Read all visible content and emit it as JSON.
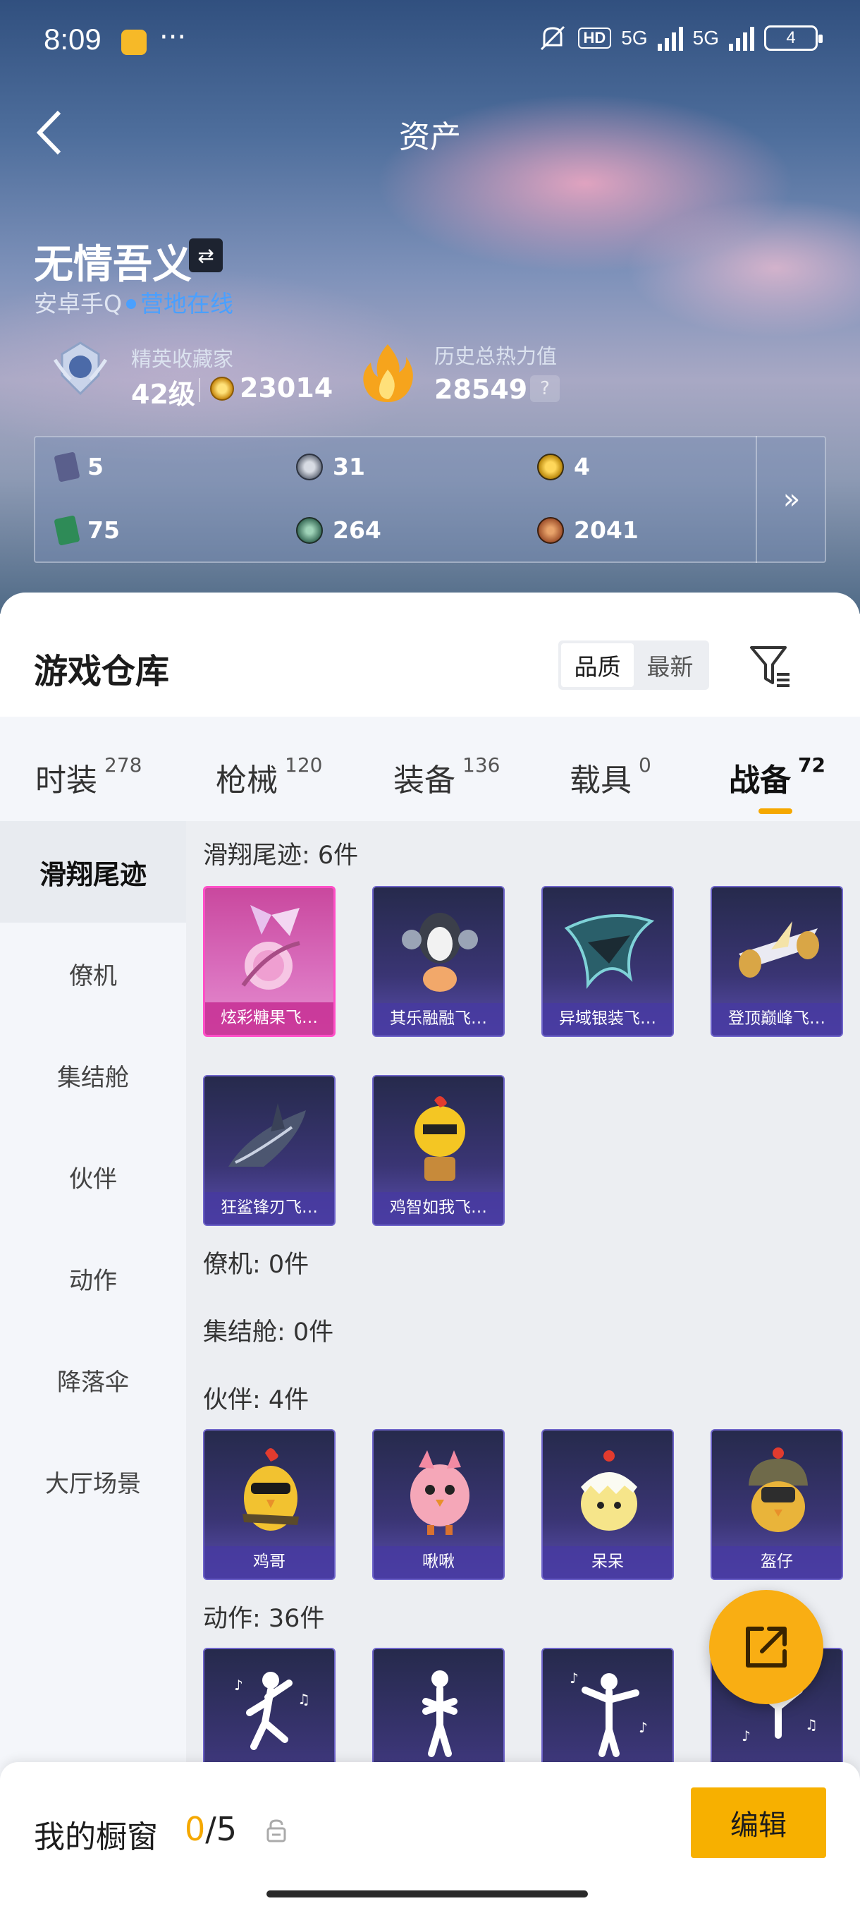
{
  "status_bar": {
    "time": "8:09",
    "more": "···",
    "hd_label": "HD",
    "net1": "5G",
    "net2": "5G",
    "battery": "4"
  },
  "header": {
    "title": "资产"
  },
  "profile": {
    "username": "无情吾义",
    "platform": "安卓手Q",
    "online_status": "营地在线",
    "rank_title": "精英收藏家",
    "rank_level": "42级",
    "coin_value": "23014",
    "heat_title": "历史总热力值",
    "heat_value": "28549",
    "heat_help": "?"
  },
  "currencies": [
    {
      "icon": "card-icon",
      "value": "5",
      "color": "#5a5f8c"
    },
    {
      "icon": "silver-coin-icon",
      "value": "31",
      "color": "#6b7280"
    },
    {
      "icon": "gold-coin-icon",
      "value": "4",
      "color": "#b8860b"
    },
    {
      "icon": "green-card-icon",
      "value": "75",
      "color": "#2e8b57"
    },
    {
      "icon": "gem-icon",
      "value": "264",
      "color": "#3b6e5a"
    },
    {
      "icon": "bronze-coin-icon",
      "value": "2041",
      "color": "#a0522d"
    }
  ],
  "warehouse": {
    "title": "游戏仓库",
    "sort_options": [
      "品质",
      "最新"
    ],
    "sort_selected": "品质"
  },
  "tabs": [
    {
      "label": "时装",
      "count": "278"
    },
    {
      "label": "枪械",
      "count": "120"
    },
    {
      "label": "装备",
      "count": "136"
    },
    {
      "label": "载具",
      "count": "0"
    },
    {
      "label": "战备",
      "count": "72",
      "active": true
    }
  ],
  "sidebar": {
    "items": [
      "滑翔尾迹",
      "僚机",
      "集结舱",
      "伙伴",
      "动作",
      "降落伞",
      "大厅场景"
    ],
    "active": "滑翔尾迹"
  },
  "sections": {
    "glide": {
      "label": "滑翔尾迹: 6件",
      "items": [
        "炫彩糖果飞…",
        "其乐融融飞…",
        "异域银装飞…",
        "登顶巅峰飞…",
        "狂鲨锋刃飞…",
        "鸡智如我飞…"
      ]
    },
    "wingman": {
      "label": "僚机: 0件"
    },
    "assembly": {
      "label": "集结舱: 0件"
    },
    "partner": {
      "label": "伙伴: 4件",
      "items": [
        "鸡哥",
        "啾啾",
        "呆呆",
        "盔仔"
      ]
    },
    "emote": {
      "label": "动作: 36件"
    }
  },
  "showcase": {
    "title": "我的橱窗",
    "used": "0",
    "total": "/5",
    "edit_label": "编辑"
  },
  "colors": {
    "accent": "#f7b000",
    "online": "#4aa0ff",
    "tile_purple": "#3a3574",
    "tile_pink": "#d96dbc"
  }
}
